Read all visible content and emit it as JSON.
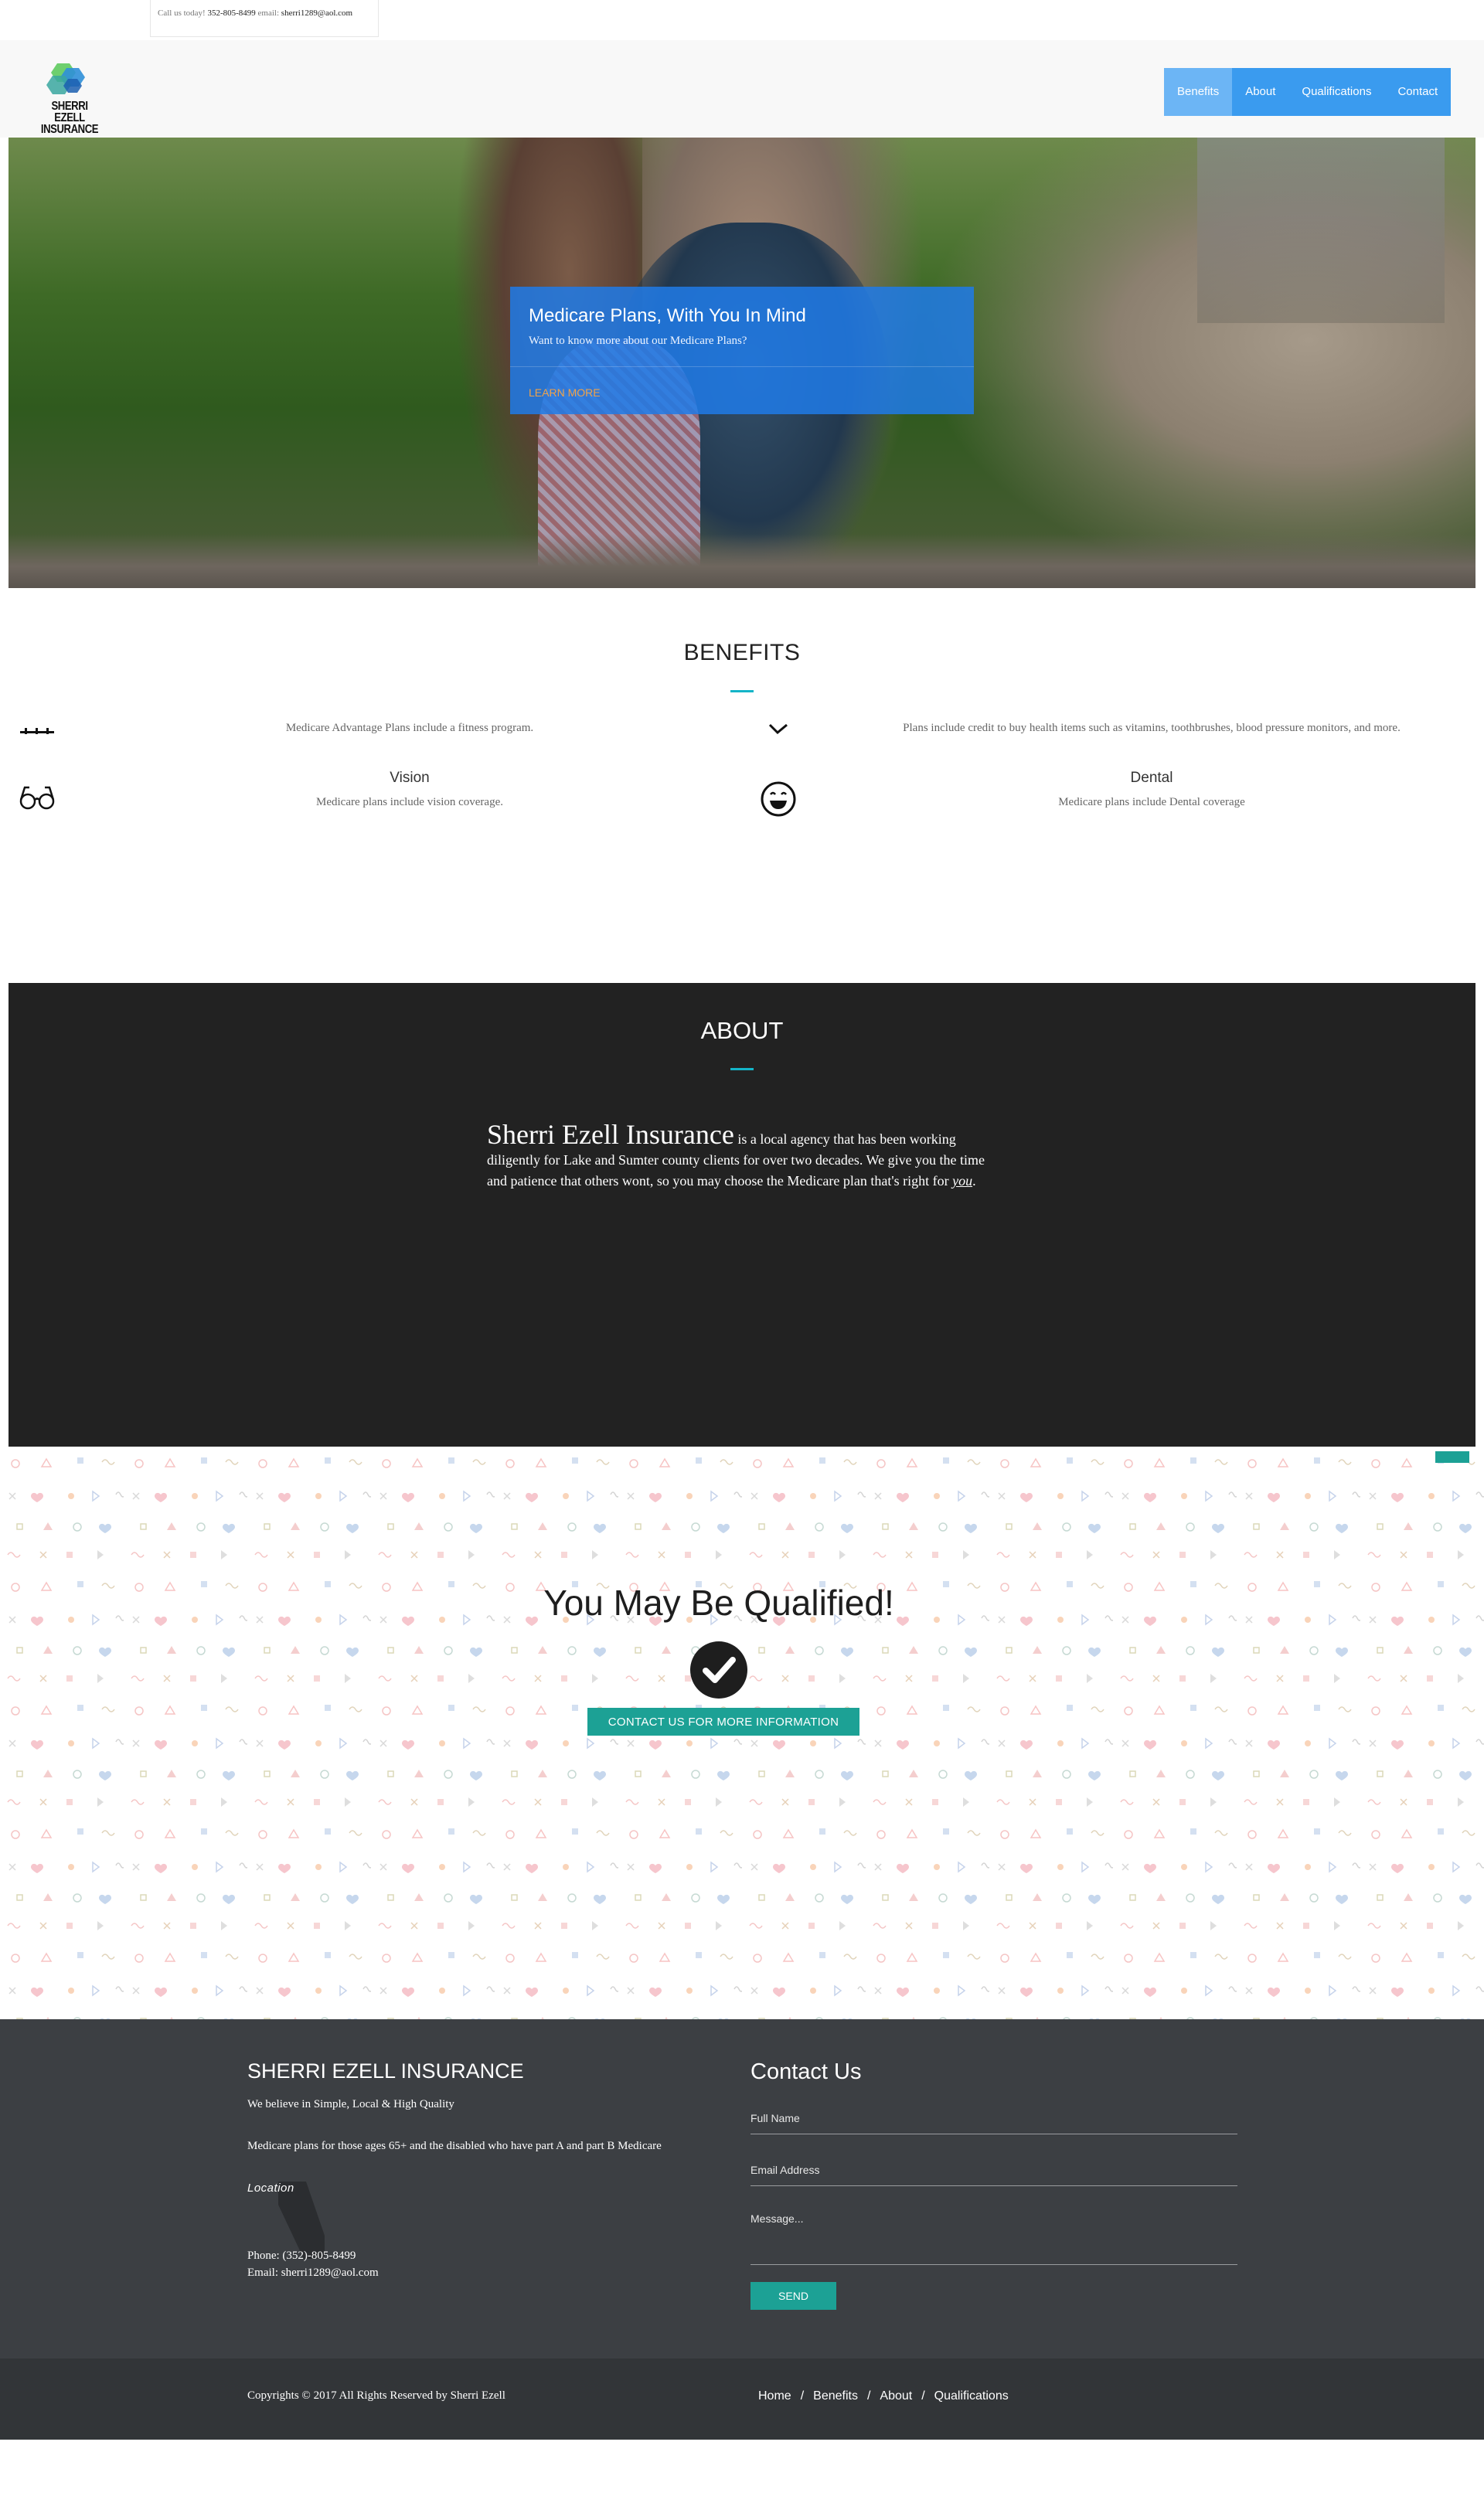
{
  "topbar": {
    "call_label": "Call us today!",
    "phone": "352-805-8499",
    "email_label": "email:",
    "email": "sherri1289@aol.com"
  },
  "header": {
    "logo_line1": "SHERRI EZELL",
    "logo_line2": "INSURANCE",
    "nav": [
      {
        "label": "Benefits",
        "active": true
      },
      {
        "label": "About"
      },
      {
        "label": "Qualifications"
      },
      {
        "label": "Contact"
      }
    ]
  },
  "hero": {
    "title": "Medicare Plans, With You In Mind",
    "subtitle": "Want to know more about our Medicare Plans?",
    "cta": "LEARN MORE"
  },
  "benefits": {
    "title": "BENEFITS",
    "clipped_left": "Medicare Advantage Plans include a fitness program.",
    "clipped_right": "Plans include credit to buy health items such as vitamins, toothbrushes, blood pressure monitors, and more.",
    "items": [
      {
        "name": "Vision",
        "desc": "Medicare plans include vision coverage.",
        "icon": "glasses-icon"
      },
      {
        "name": "Dental",
        "desc": "Medicare plans include Dental coverage",
        "icon": "smile-icon"
      }
    ]
  },
  "about": {
    "title": "ABOUT",
    "brand": "Sherri Ezell Insurance",
    "text": "is a local agency that has been working diligently for Lake and Sumter county clients for over two decades. We give you the time and patience that others wont, so you may choose the Medicare plan that's right for",
    "emphasis": "you",
    "end": "."
  },
  "qualified": {
    "title": "You May Be Qualified!",
    "button": "CONTACT US FOR MORE INFORMATION"
  },
  "footer": {
    "brand": "SHERRI EZELL INSURANCE",
    "tagline": "We believe in Simple, Local & High Quality",
    "description": "Medicare plans for those ages 65+ and the disabled who have part A and part B Medicare",
    "location": "Location",
    "phone": "Phone: (352)-805-8499",
    "email": "Email: sherri1289@aol.com",
    "contact_title": "Contact Us",
    "name_placeholder": "Full Name",
    "email_placeholder": "Email Address",
    "message_placeholder": "Message...",
    "send": "SEND"
  },
  "bottom": {
    "copyright": "Copyrights © 2017 All Rights Reserved by Sherri Ezell",
    "links": [
      "Home",
      "Benefits",
      "About",
      "Qualifications"
    ]
  },
  "colors": {
    "nav_blue": "#3a9bef",
    "nav_active": "#6cb5f5",
    "teal": "#1ca195",
    "accent_line": "#14b4c8",
    "about_bg": "#222222",
    "footer_bg": "#3c3f43"
  }
}
